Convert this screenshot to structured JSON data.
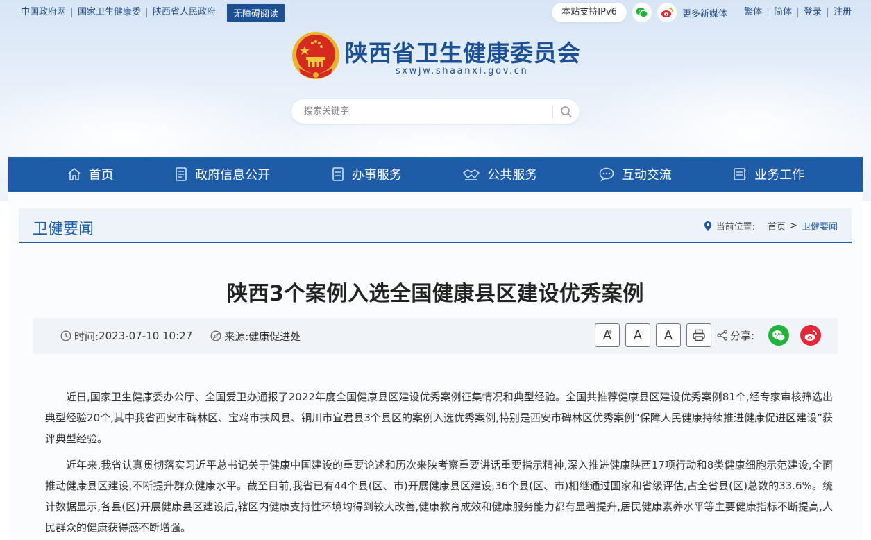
{
  "top_links": [
    "中国政府网",
    "国家卫生健康委",
    "陕西省人民政府"
  ],
  "accessible_label": "无障碍阅读",
  "ipv6_label": "本站支持IPv6",
  "more_media": "更多新媒体",
  "top_right_links": [
    "繁体",
    "简体",
    "登录",
    "注册"
  ],
  "site": {
    "name": "陕西省卫生健康委员会",
    "domain": "sxwjw.shaanxi.gov.cn"
  },
  "search": {
    "placeholder": "搜索关键字"
  },
  "nav": [
    {
      "label": "首页",
      "icon": "home-icon"
    },
    {
      "label": "政府信息公开",
      "icon": "document-icon"
    },
    {
      "label": "办事服务",
      "icon": "service-icon"
    },
    {
      "label": "公共服务",
      "icon": "handshake-icon"
    },
    {
      "label": "互动交流",
      "icon": "chat-icon"
    },
    {
      "label": "业务工作",
      "icon": "briefcase-icon"
    }
  ],
  "section": {
    "title": "卫健要闻",
    "crumb_label": "当前位置:",
    "crumb_home": "首页",
    "crumb_sep": ">",
    "crumb_current": "卫健要闻"
  },
  "article": {
    "title": "陕西3个案例入选全国健康县区建设优秀案例",
    "time_label": "时间:",
    "time_value": "2023-07-10 10:27",
    "source_label": "来源:",
    "source_value": "健康促进处",
    "font_large": "A",
    "font_small": "A",
    "font_default": "A",
    "share_label": "分享:",
    "paragraphs": [
      "近日,国家卫生健康委办公厅、全国爱卫办通报了2022年度全国健康县区建设优秀案例征集情况和典型经验。全国共推荐健康县区建设优秀案例81个,经专家审核筛选出典型经验20个,其中我省西安市碑林区、宝鸡市扶风县、铜川市宜君县3个县区的案例入选优秀案例,特别是西安市碑林区优秀案例“保障人民健康持续推进健康促进区建设”获评典型经验。",
      "近年来,我省认真贯彻落实习近平总书记关于健康中国建设的重要论述和历次来陕考察重要讲话重要指示精神,深入推进健康陕西17项行动和8类健康细胞示范建设,全面推动健康县区建设,不断提升群众健康水平。截至目前,我省已有44个县(区、市)开展健康县区建设,36个县(区、市)相继通过国家和省级评估,占全省县(区)总数的33.6%。统计数据显示,各县(区)开展健康县区建设后,辖区内健康支持性环境均得到较大改善,健康教育成效和健康服务能力都有显著提升,居民健康素养水平等主要健康指标不断提高,人民群众的健康获得感不断增强。"
    ]
  },
  "colors": {
    "primary": "#1f5ca8",
    "wechat": "#21b33a",
    "weibo": "#e2283a"
  }
}
